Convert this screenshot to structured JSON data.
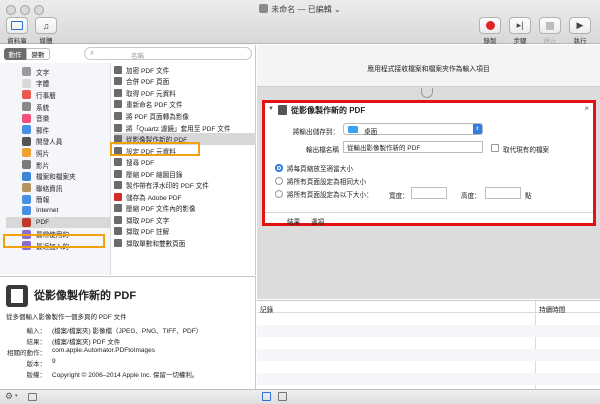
{
  "window": {
    "title": "未命名 — 已編輯",
    "title_arrow": "⌄"
  },
  "toolbar": {
    "library_label": "資料庫",
    "media_label": "媒體",
    "record_label": "錄製",
    "step_label": "步驟",
    "stop_label": "停止",
    "run_label": "執行"
  },
  "library": {
    "tab_actions": "動作",
    "tab_variables": "變數",
    "search_placeholder": "名稱",
    "categories": [
      "文字",
      "字體",
      "行事曆",
      "系統",
      "音樂",
      "郵件",
      "開發人員",
      "照片",
      "影片",
      "檔案和檔案夾",
      "聯絡資訊",
      "簡報",
      "Internet",
      "PDF",
      "最常使用的",
      "最近加入的"
    ],
    "actions": [
      "加密 PDF 文件",
      "合併 PDF 頁面",
      "取得 PDF 元資料",
      "重新命名 PDF 文件",
      "將 PDF 頁面轉為影像",
      "將「Quartz 濾鏡」套用至 PDF 文件",
      "從影像製作新的 PDF",
      "設定 PDF 元資料",
      "搜尋 PDF",
      "壓縮 PDF 縮圖目錄",
      "製作帶有浮水印的 PDF 文件",
      "儲存為 Adobe PDF",
      "壓縮 PDF 文件內的影像",
      "擷取 PDF 文字",
      "擷取 PDF 註解",
      "擷取單數和雙數頁面"
    ]
  },
  "description": {
    "title": "從影像製作新的 PDF",
    "summary": "從多個輸入影像製作一個多頁的 PDF 文件",
    "rows": [
      {
        "key": "輸入：",
        "value": "(檔案/檔案夾) 影像檔（JPEG、PNG、TIFF、PDF）"
      },
      {
        "key": "結果：",
        "value": "(檔案/檔案夾) PDF 文件"
      },
      {
        "key": "相關的動作：",
        "value": "com.apple.Automator.PDFtoImages"
      },
      {
        "key": "版本：",
        "value": "9"
      },
      {
        "key": "版權：",
        "value": "Copyright © 2006–2014 Apple Inc. 保留一切權利。"
      }
    ]
  },
  "workflow": {
    "hint": "應用程式接收檔案和檔案夾作為輸入項目",
    "action": {
      "title": "從影像製作新的 PDF",
      "save_to_label": "將輸出儲存到：",
      "save_to_value": "桌面",
      "filename_label": "輸出檔名稱",
      "filename_value": "從輸出影像製作新的 PDF",
      "replace_label": "取代現有的檔案",
      "options": [
        "將每頁縮放至適當大小",
        "將所有頁面設定為相同大小",
        "將所有頁面設定為以下大小："
      ],
      "width_label": "寬度：",
      "height_label": "高度：",
      "unit_label": "點",
      "tab_results": "結果",
      "tab_options": "選項"
    }
  },
  "log": {
    "col_log": "記錄",
    "col_duration": "持續時間"
  },
  "colors": {
    "highlight": "#f0a20c",
    "selected_row": "#d8d8d8",
    "red_frame": "#e31212"
  }
}
